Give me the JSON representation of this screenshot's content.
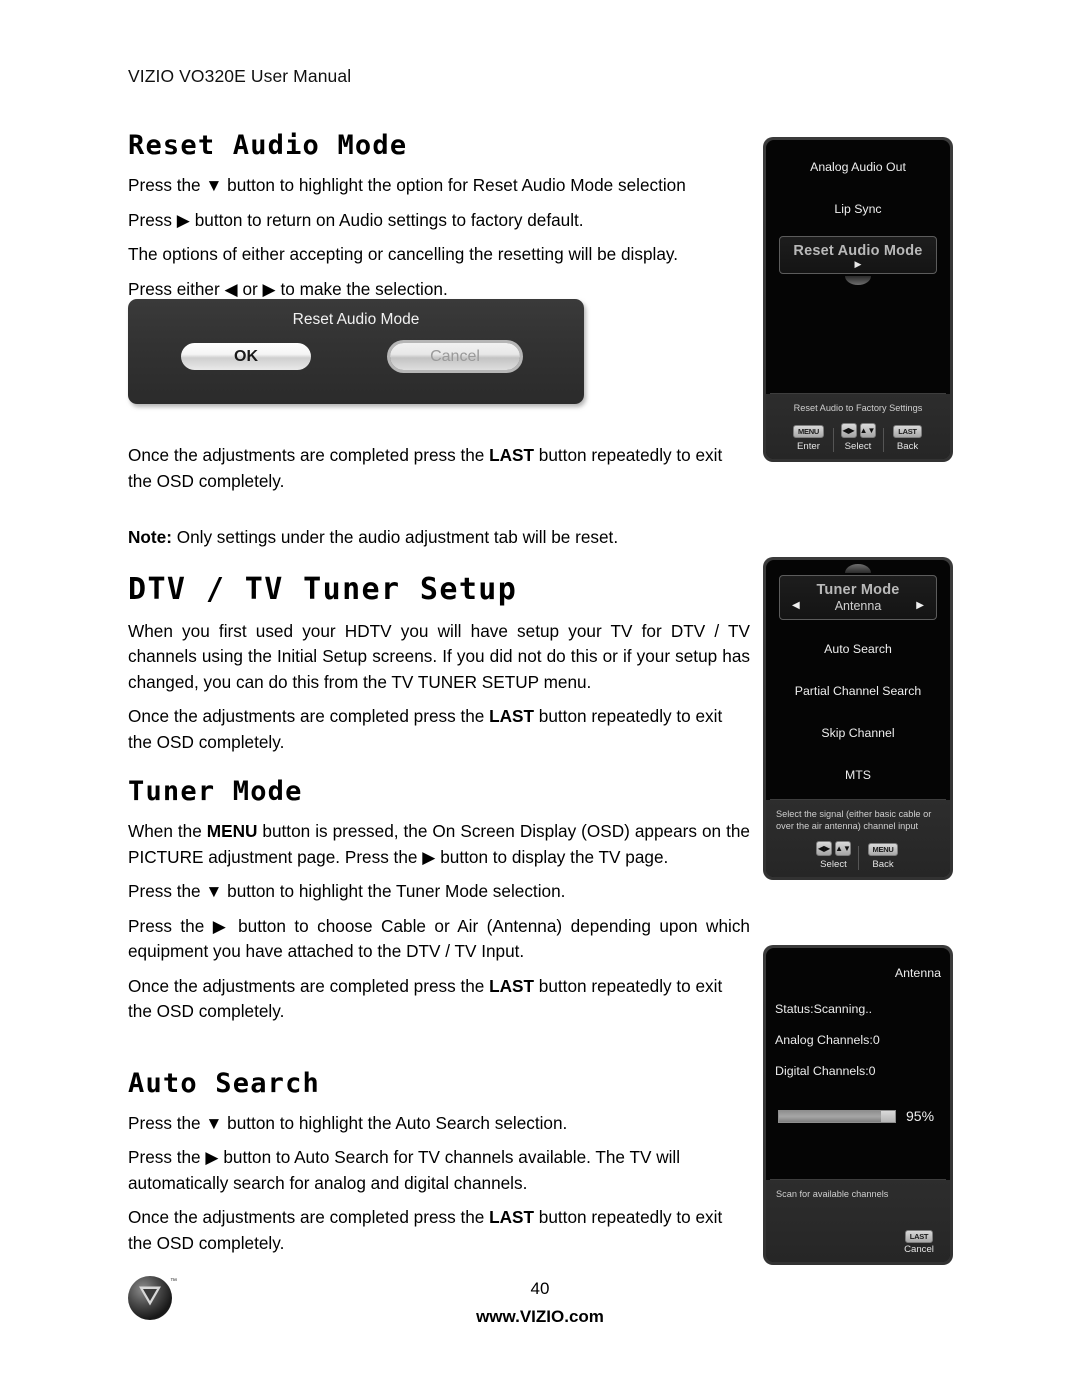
{
  "header": {
    "title": "VIZIO VO320E User Manual"
  },
  "sections": {
    "reset_audio": {
      "heading": "Reset Audio Mode",
      "p1": "Press the ▼ button to highlight the option for Reset Audio Mode selection",
      "p2": "Press ▶ button to return on Audio settings to factory default.",
      "p3": "The options of either accepting or cancelling the resetting will be display.",
      "p4": "Press either ◀ or ▶ to make the selection.",
      "after1_pre": "Once the adjustments are completed press the ",
      "after1_bold": "LAST",
      "after1_post": " button repeatedly to exit the OSD completely.",
      "note_label": "Note:",
      "note_text": " Only settings under the audio adjustment tab will be reset."
    },
    "dtv_tuner": {
      "heading": "DTV / TV Tuner Setup",
      "p1": "When you first used your HDTV you will have setup your TV for DTV / TV channels using the Initial Setup screens.  If you did not do this or if your setup has changed, you can do this from the TV TUNER SETUP menu.",
      "after_pre": "Once the adjustments are completed press the ",
      "after_bold": "LAST",
      "after_post": " button repeatedly to exit the OSD completely."
    },
    "tuner_mode": {
      "heading": "Tuner Mode",
      "p1_pre": "When the ",
      "p1_bold": "MENU",
      "p1_post": " button is pressed, the On Screen Display (OSD) appears on the PICTURE adjustment page. Press the ▶ button to display the TV page.",
      "p2": "Press the ▼ button to highlight the Tuner Mode selection.",
      "p3": "Press the ▶ button to choose Cable or Air (Antenna) depending upon which equipment you have attached to the DTV / TV Input.",
      "after_pre": "Once the adjustments are completed press the ",
      "after_bold": "LAST",
      "after_post": " button repeatedly to exit the OSD completely."
    },
    "auto_search": {
      "heading": "Auto Search",
      "p1": "Press the ▼ button to highlight the Auto Search selection.",
      "p2": "Press the ▶ button to Auto Search for TV channels available. The TV will automatically search for analog and digital channels.",
      "after_pre": "Once the adjustments are completed press the ",
      "after_bold": "LAST",
      "after_post": " button repeatedly to exit the OSD completely."
    }
  },
  "dialog": {
    "title": "Reset Audio Mode",
    "ok_label": "OK",
    "cancel_label": "Cancel"
  },
  "osd_audio": {
    "items": [
      {
        "label": "Analog Audio Out"
      },
      {
        "label": "Lip Sync"
      }
    ],
    "highlight": {
      "label": "Reset Audio Mode",
      "arrow": "▶"
    },
    "help": "Reset Audio to Factory Settings",
    "legend": [
      {
        "key": "MENU",
        "label": "Enter",
        "type": "text"
      },
      {
        "key": "◀▶▲▼",
        "label": "Select",
        "type": "arrows"
      },
      {
        "key": "LAST",
        "label": "Back",
        "type": "text"
      }
    ]
  },
  "osd_tuner": {
    "highlight": {
      "title": "Tuner Mode",
      "value": "Antenna",
      "left_arrow": "◀",
      "right_arrow": "▶"
    },
    "items": [
      {
        "label": "Auto Search"
      },
      {
        "label": "Partial Channel Search"
      },
      {
        "label": "Skip Channel"
      },
      {
        "label": "MTS"
      }
    ],
    "help": "Select the signal (either basic cable or over the air antenna) channel input",
    "legend": [
      {
        "key": "◀▶▲▼",
        "label": "Select",
        "type": "arrows"
      },
      {
        "key": "MENU",
        "label": "Back",
        "type": "text"
      }
    ]
  },
  "osd_scan": {
    "source": "Antenna",
    "status": "Status:Scanning..",
    "analog": "Analog Channels:0",
    "digital": "Digital Channels:0",
    "progress_label": "95%",
    "progress_value": 88,
    "help": "Scan for available channels",
    "legend": [
      {
        "key": "LAST",
        "label": "Cancel",
        "type": "text"
      }
    ]
  },
  "footer": {
    "page_number": "40",
    "website": "www.VIZIO.com",
    "logo_tm": "™"
  }
}
